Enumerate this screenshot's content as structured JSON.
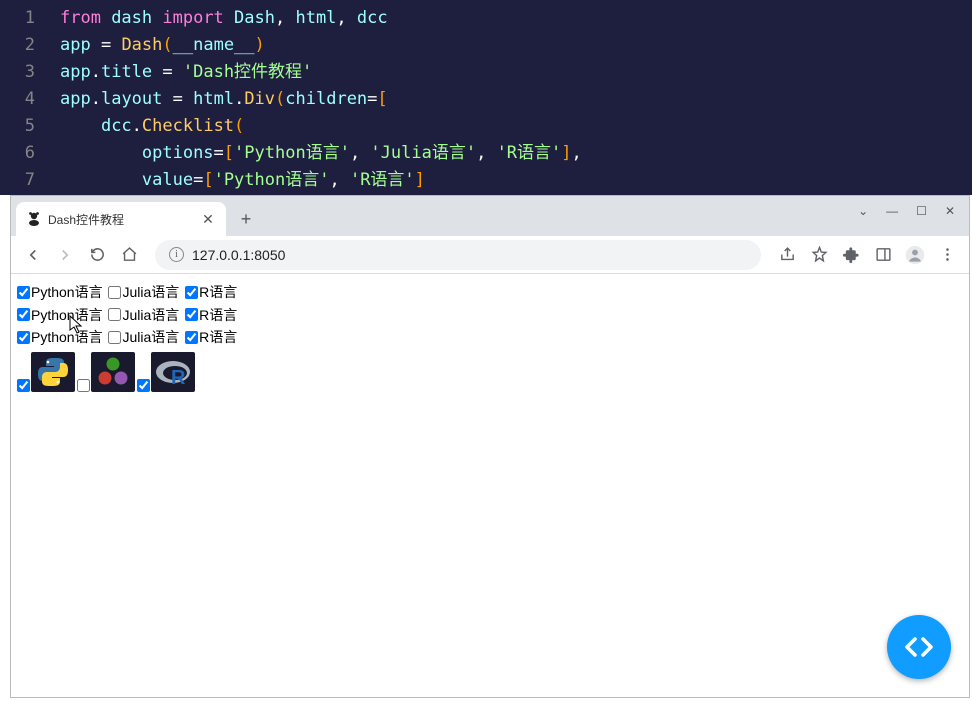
{
  "editor": {
    "lines": [
      {
        "n": "1",
        "tokens": [
          [
            "pink",
            "from "
          ],
          [
            "cyan",
            "dash "
          ],
          [
            "pink",
            "import "
          ],
          [
            "cyan",
            "Dash"
          ],
          [
            "white",
            ", "
          ],
          [
            "cyan",
            "html"
          ],
          [
            "white",
            ", "
          ],
          [
            "cyan",
            "dcc"
          ]
        ]
      },
      {
        "n": "2",
        "tokens": [
          [
            "cyan",
            "app "
          ],
          [
            "white",
            "= "
          ],
          [
            "yellow",
            "Dash"
          ],
          [
            "orange",
            "("
          ],
          [
            "cyan",
            "__name__"
          ],
          [
            "orange",
            ")"
          ]
        ]
      },
      {
        "n": "3",
        "tokens": [
          [
            "cyan",
            "app"
          ],
          [
            "white",
            "."
          ],
          [
            "cyan",
            "title "
          ],
          [
            "white",
            "= "
          ],
          [
            "green",
            "'Dash控件教程'"
          ]
        ]
      },
      {
        "n": "4",
        "tokens": [
          [
            "cyan",
            "app"
          ],
          [
            "white",
            "."
          ],
          [
            "cyan",
            "layout "
          ],
          [
            "white",
            "= "
          ],
          [
            "cyan",
            "html"
          ],
          [
            "white",
            "."
          ],
          [
            "yellow",
            "Div"
          ],
          [
            "orange",
            "("
          ],
          [
            "cyan",
            "children"
          ],
          [
            "white",
            "="
          ],
          [
            "orange",
            "["
          ]
        ]
      },
      {
        "n": "5",
        "tokens": [
          [
            "white",
            "    "
          ],
          [
            "cyan",
            "dcc"
          ],
          [
            "white",
            "."
          ],
          [
            "yellow",
            "Checklist"
          ],
          [
            "orange",
            "("
          ]
        ]
      },
      {
        "n": "6",
        "tokens": [
          [
            "white",
            "        "
          ],
          [
            "cyan",
            "options"
          ],
          [
            "white",
            "="
          ],
          [
            "orange",
            "["
          ],
          [
            "green",
            "'Python语言'"
          ],
          [
            "white",
            ", "
          ],
          [
            "green",
            "'Julia语言'"
          ],
          [
            "white",
            ", "
          ],
          [
            "green",
            "'R语言'"
          ],
          [
            "orange",
            "]"
          ],
          [
            "white",
            ","
          ]
        ]
      },
      {
        "n": "7",
        "tokens": [
          [
            "white",
            "        "
          ],
          [
            "cyan",
            "value"
          ],
          [
            "white",
            "="
          ],
          [
            "orange",
            "["
          ],
          [
            "green",
            "'Python语言'"
          ],
          [
            "white",
            ", "
          ],
          [
            "green",
            "'R语言'"
          ],
          [
            "orange",
            "]"
          ]
        ]
      }
    ]
  },
  "browser": {
    "tab_title": "Dash控件教程",
    "url": "127.0.0.1:8050",
    "window": {
      "caret": "⌄",
      "min": "—",
      "max": "☐",
      "close": "✕"
    },
    "toolbar": {
      "new_tab": "+",
      "tab_close": "✕"
    }
  },
  "checklist": {
    "rows": [
      [
        {
          "label": "Python语言",
          "checked": true
        },
        {
          "label": "Julia语言",
          "checked": false
        },
        {
          "label": "R语言",
          "checked": true
        }
      ],
      [
        {
          "label": "Python语言",
          "checked": true
        },
        {
          "label": "Julia语言",
          "checked": false
        },
        {
          "label": "R语言",
          "checked": true
        }
      ],
      [
        {
          "label": "Python语言",
          "checked": true
        },
        {
          "label": "Julia语言",
          "checked": false
        },
        {
          "label": "R语言",
          "checked": true
        }
      ]
    ],
    "img_row": [
      {
        "name": "python",
        "checked": true
      },
      {
        "name": "julia",
        "checked": false
      },
      {
        "name": "r",
        "checked": true
      }
    ]
  }
}
